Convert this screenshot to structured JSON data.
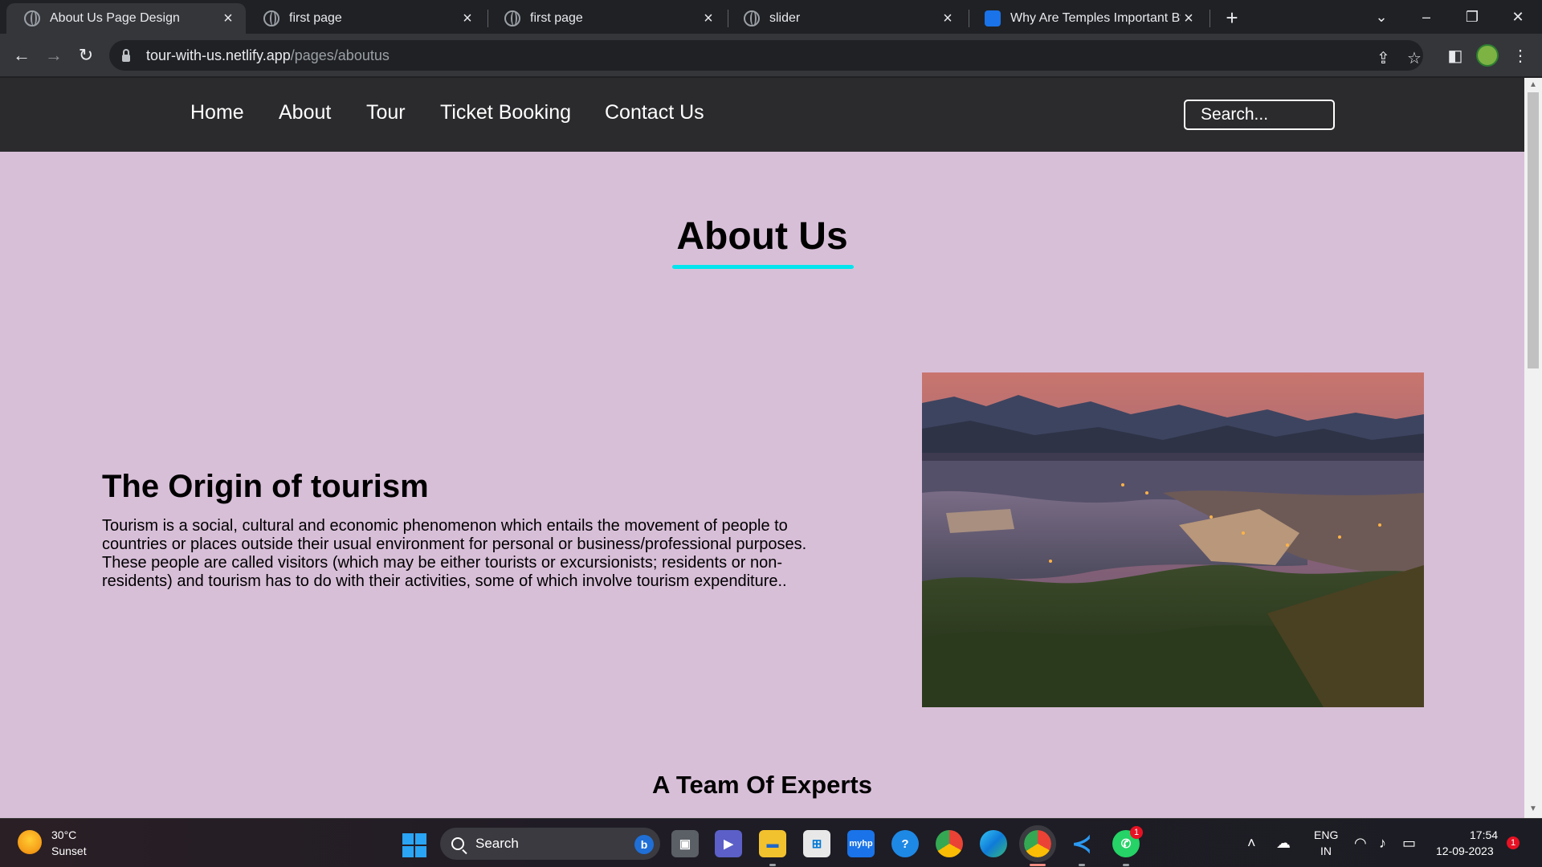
{
  "browser": {
    "tabs": [
      {
        "title": "About Us Page Design",
        "active": true
      },
      {
        "title": "first page",
        "active": false
      },
      {
        "title": "first page",
        "active": false
      },
      {
        "title": "slider",
        "active": false
      },
      {
        "title": "Why Are Temples Important By U",
        "active": false
      }
    ],
    "url_domain": "tour-with-us.netlify.app",
    "url_path": "/pages/aboutus"
  },
  "site": {
    "nav": [
      "Home",
      "About",
      "Tour",
      "Ticket Booking",
      "Contact Us"
    ],
    "search_placeholder": "Search...",
    "page_title": "About Us",
    "origin_heading": "The Origin of tourism",
    "origin_text": "Tourism is a social, cultural and economic phenomenon which entails the movement of people to countries or places outside their usual environment for personal or business/professional purposes. These people are called visitors (which may be either tourists or excursionists; residents or non-residents) and tourism has to do with their activities, some of which involve tourism expenditure..",
    "team_heading": "A Team Of Experts"
  },
  "taskbar": {
    "weather_temp": "30°C",
    "weather_condition": "Sunset",
    "search_label": "Search",
    "language": "ENG",
    "region": "IN",
    "time": "17:54",
    "date": "12-09-2023",
    "whatsapp_badge": "1",
    "notification_badge": "1"
  },
  "colors": {
    "page_background": "#d8bfd8",
    "nav_background": "#2b2b2e",
    "title_underline": "#00e5ee"
  }
}
